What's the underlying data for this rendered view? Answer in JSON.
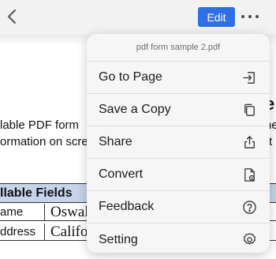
{
  "toolbar": {
    "back_icon": "chevron-left-icon",
    "edit_label": "Edit",
    "edit_color": "#2f6fe6",
    "more_icon": "more-horizontal-icon"
  },
  "document": {
    "line1": "lable PDF form",
    "line2": "ormation on scre",
    "heading_fragment": "e",
    "line1_right": "he",
    "line2_right": "rt",
    "table_header": "llable Fields",
    "rows": [
      {
        "label": "ame",
        "value": "Oswal"
      },
      {
        "label": "ddress",
        "value": "Califo"
      }
    ]
  },
  "menu": {
    "title": "pdf form sample 2.pdf",
    "items": [
      {
        "label": "Go to Page",
        "icon": "go-to-page-icon"
      },
      {
        "label": "Save a Copy",
        "icon": "copy-icon"
      },
      {
        "label": "Share",
        "icon": "share-icon"
      },
      {
        "label": "Convert",
        "icon": "convert-file-icon"
      },
      {
        "label": "Feedback",
        "icon": "help-circle-icon"
      },
      {
        "label": "Setting",
        "icon": "gear-icon"
      }
    ]
  }
}
